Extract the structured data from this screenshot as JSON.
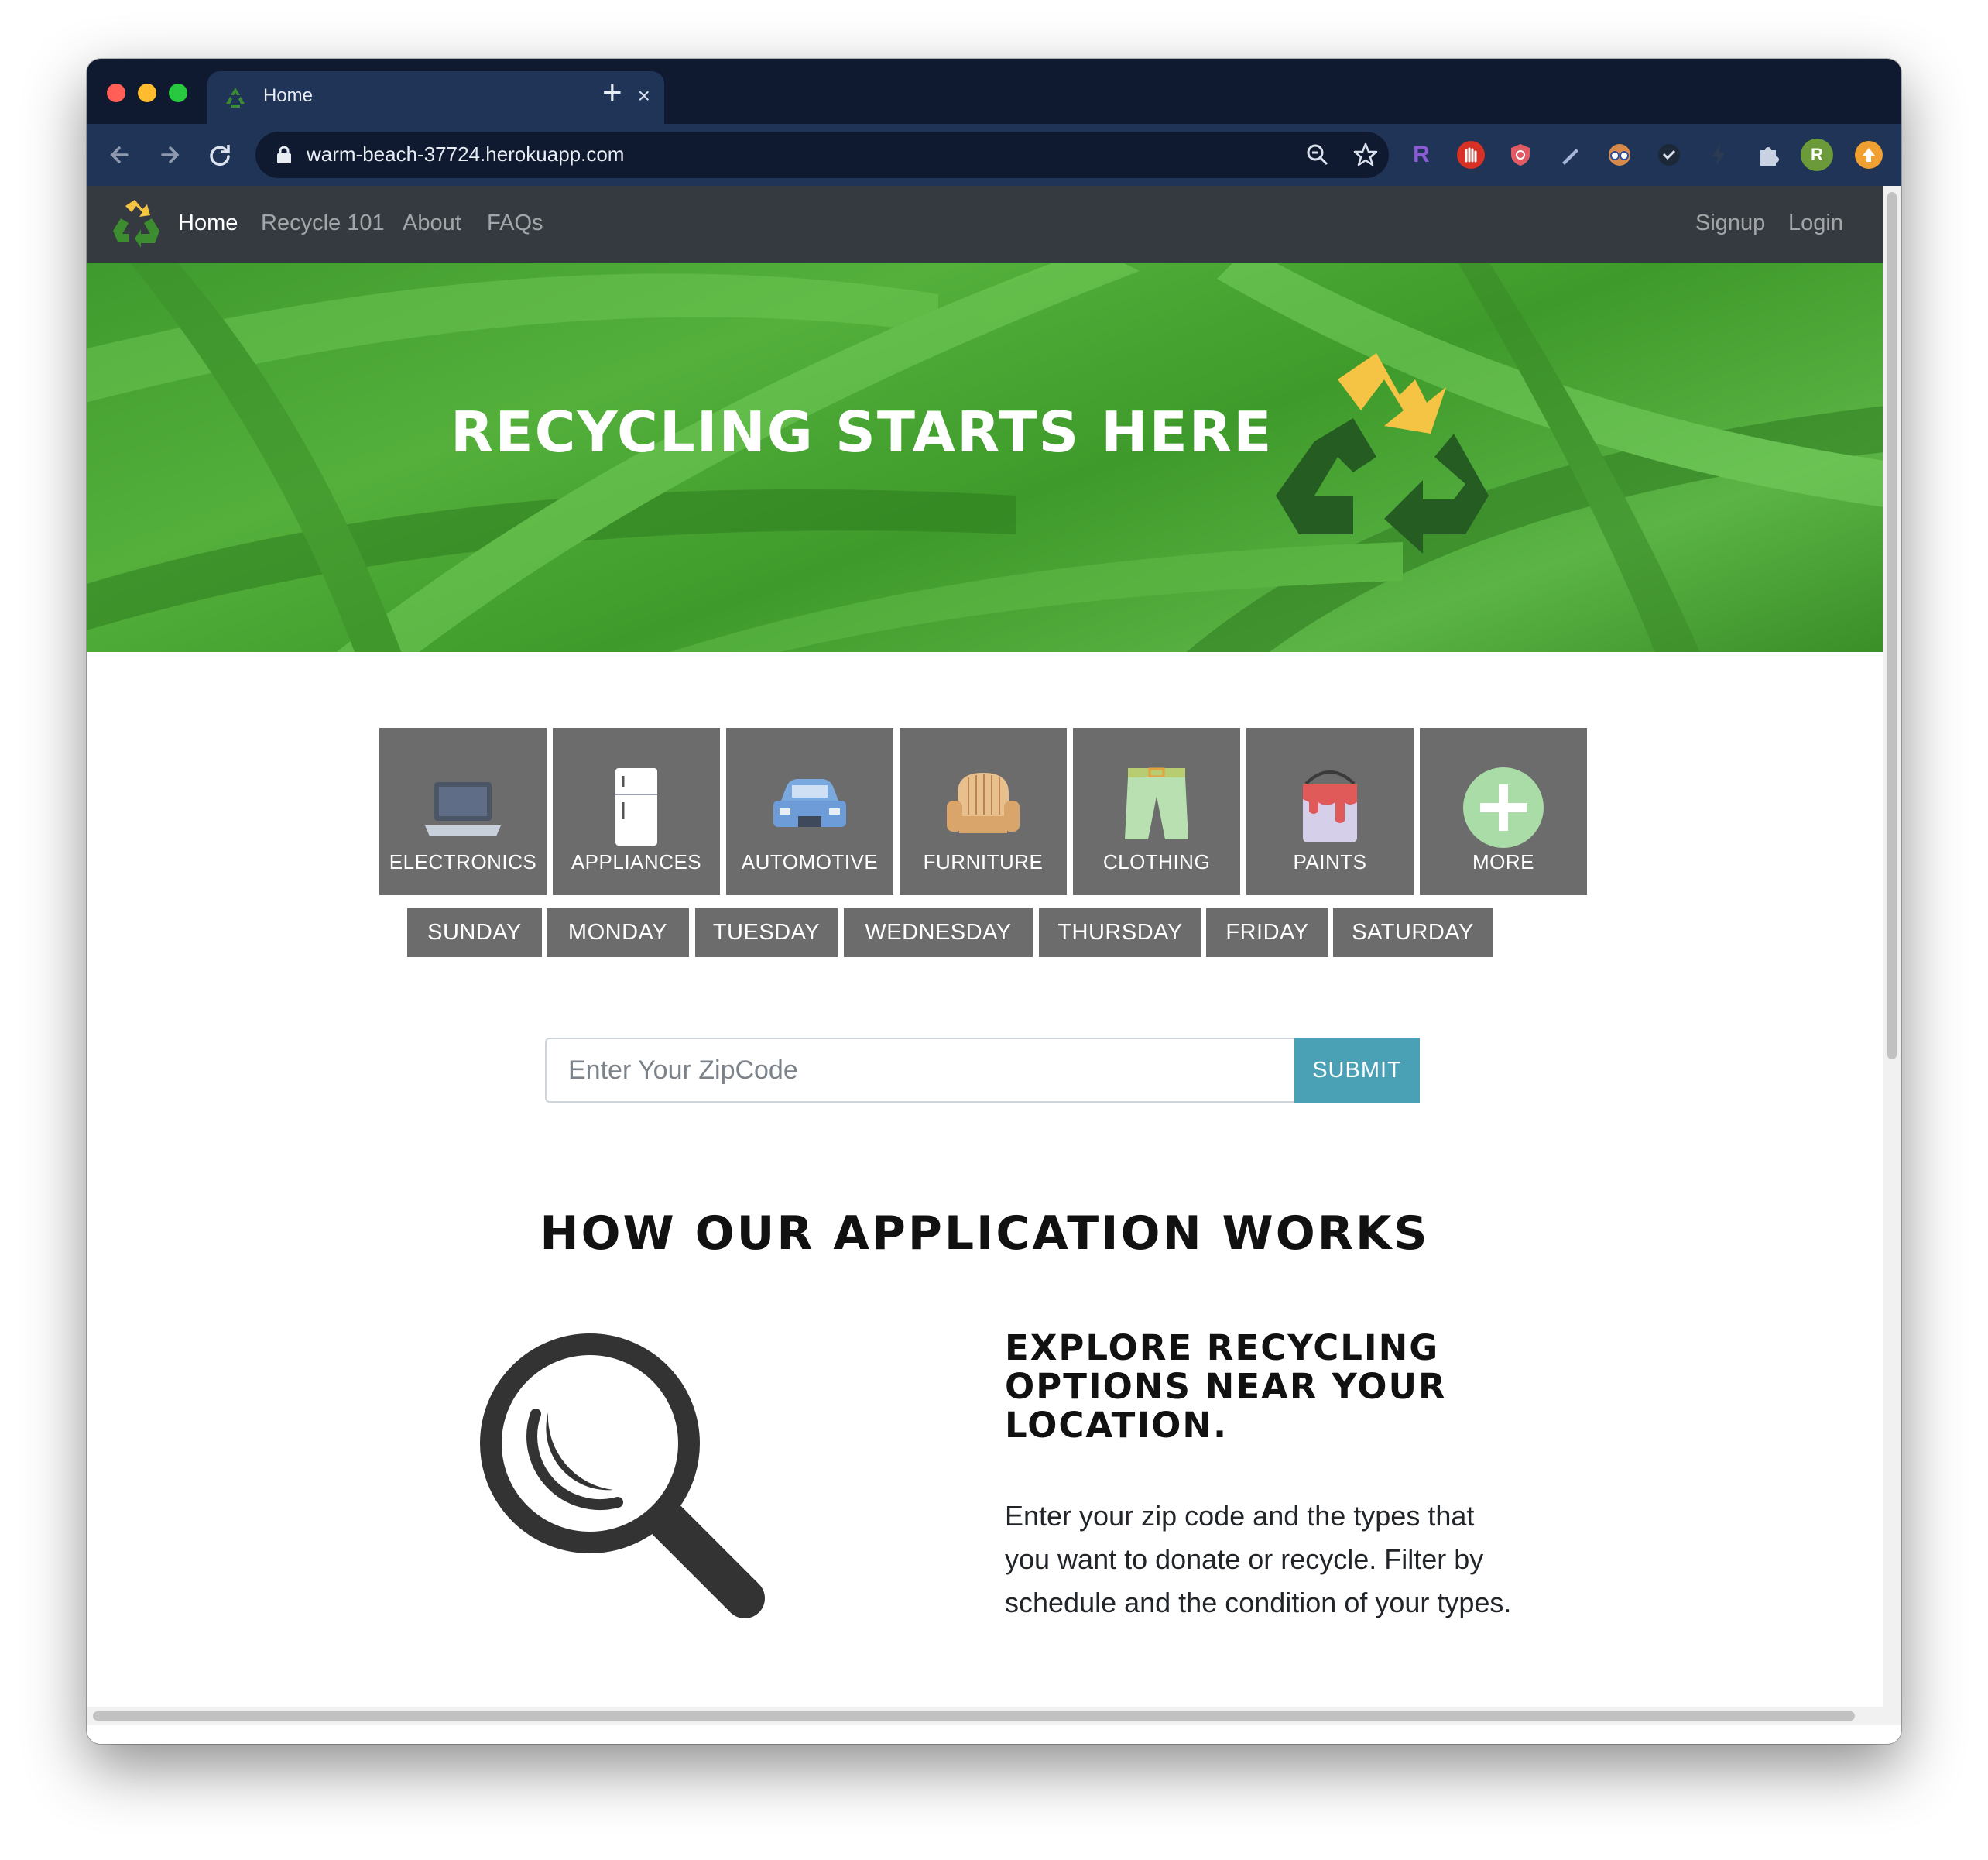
{
  "browser": {
    "tab_title": "Home",
    "tab_close": "×",
    "new_tab": "+",
    "url": "warm-beach-37724.herokuapp.com",
    "profile_initial": "R",
    "ext_r_label": "R"
  },
  "nav": {
    "links": [
      "Home",
      "Recycle 101",
      "About",
      "FAQs"
    ],
    "right_links": [
      "Signup",
      "Login"
    ]
  },
  "hero": {
    "title": "RECYCLING STARTS HERE"
  },
  "categories": [
    "ELECTRONICS",
    "APPLIANCES",
    "AUTOMOTIVE",
    "FURNITURE",
    "CLOTHING",
    "PAINTS",
    "MORE"
  ],
  "days": [
    "SUNDAY",
    "MONDAY",
    "TUESDAY",
    "WEDNESDAY",
    "THURSDAY",
    "FRIDAY",
    "SATURDAY"
  ],
  "zip": {
    "placeholder": "Enter Your ZipCode",
    "submit": "SUBMIT"
  },
  "how": {
    "title": "HOW OUR APPLICATION WORKS",
    "step_title": "EXPLORE RECYCLING OPTIONS NEAR YOUR LOCATION.",
    "step_text": "Enter your zip code and the types that you want to donate or recycle. Filter by schedule and the condition of your types."
  },
  "colors": {
    "navbar": "#343a40",
    "tile": "#6c6c6c",
    "submit": "#4aa0b5",
    "hero_green": "#4aa334"
  }
}
